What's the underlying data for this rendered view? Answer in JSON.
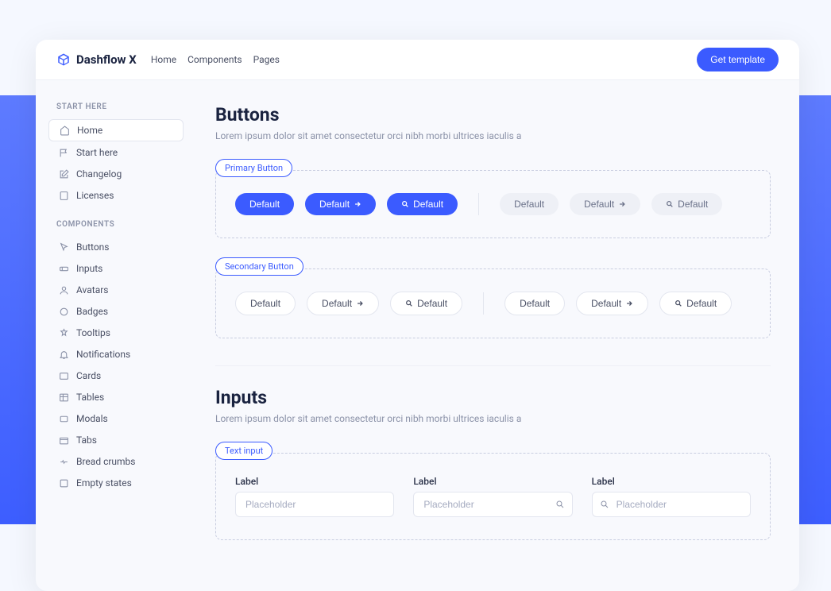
{
  "header": {
    "brand": "Dashflow X",
    "nav": [
      "Home",
      "Components",
      "Pages"
    ],
    "cta": "Get template"
  },
  "sidebar": {
    "sections": [
      {
        "heading": "START HERE",
        "items": [
          "Home",
          "Start here",
          "Changelog",
          "Licenses"
        ]
      },
      {
        "heading": "COMPONENTS",
        "items": [
          "Buttons",
          "Inputs",
          "Avatars",
          "Badges",
          "Tooltips",
          "Notifications",
          "Cards",
          "Tables",
          "Modals",
          "Tabs",
          "Bread crumbs",
          "Empty states"
        ]
      }
    ]
  },
  "buttons_section": {
    "title": "Buttons",
    "desc": "Lorem ipsum dolor sit amet consectetur orci nibh morbi ultrices iaculis a",
    "primary_tag": "Primary Button",
    "secondary_tag": "Secondary Button",
    "btn_label": "Default"
  },
  "inputs_section": {
    "title": "Inputs",
    "desc": "Lorem ipsum dolor sit amet consectetur orci nibh morbi ultrices iaculis a",
    "text_input_tag": "Text input",
    "label": "Label",
    "placeholder": "Placeholder"
  }
}
